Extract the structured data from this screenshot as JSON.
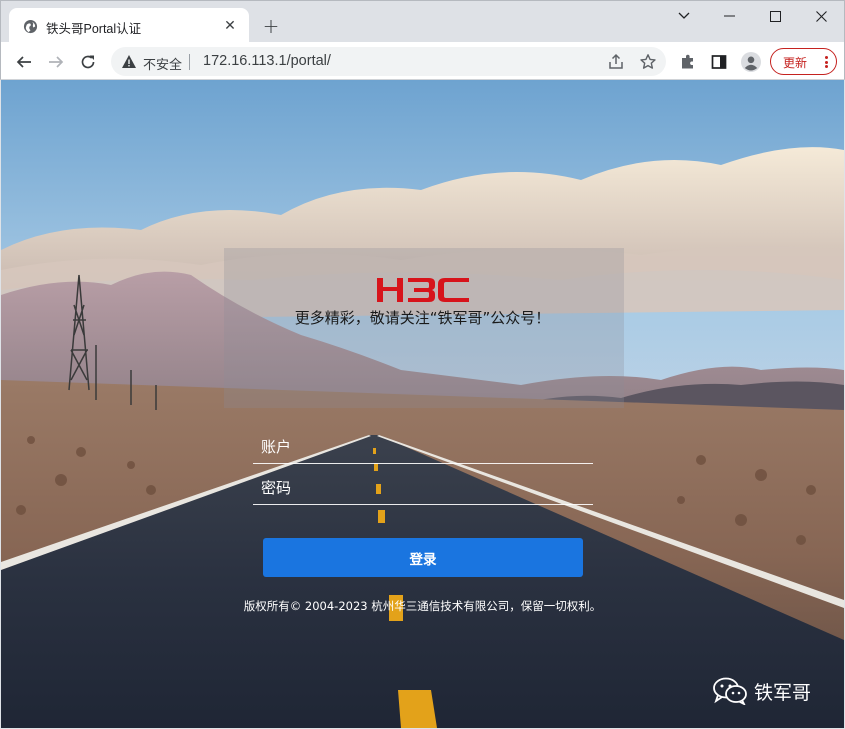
{
  "browser": {
    "tab_title": "铁头哥Portal认证",
    "security_label": "不安全",
    "url": "172.16.113.1/portal/",
    "update_label": "更新"
  },
  "page": {
    "logo_text": "H3C",
    "slogan": "更多精彩，敬请关注“铁军哥”公众号！",
    "username_placeholder": "账户",
    "password_placeholder": "密码",
    "login_label": "登录",
    "copyright": "版权所有© 2004-2023 杭州华三通信技术有限公司，保留一切权利。",
    "watermark": "铁军哥"
  },
  "colors": {
    "brand_red": "#d7141b",
    "login_blue": "#1a75e0"
  }
}
